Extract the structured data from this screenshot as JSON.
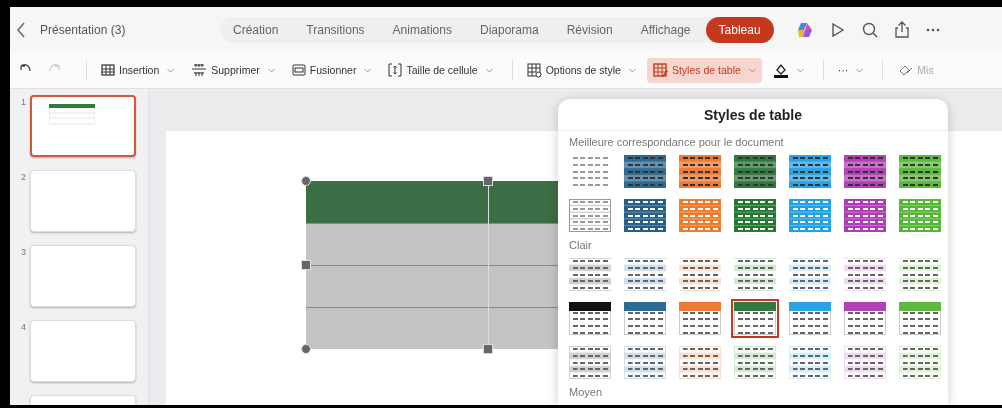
{
  "title_bar": {
    "document_title": "Présentation (3)",
    "tabs": [
      {
        "label": "Création",
        "selected": false
      },
      {
        "label": "Transitions",
        "selected": false
      },
      {
        "label": "Animations",
        "selected": false
      },
      {
        "label": "Diaporama",
        "selected": false
      },
      {
        "label": "Révision",
        "selected": false
      },
      {
        "label": "Affichage",
        "selected": false
      },
      {
        "label": "Tableau",
        "selected": true
      }
    ]
  },
  "toolbar": {
    "undo": {
      "disabled": false
    },
    "redo": {
      "disabled": true
    },
    "items": [
      {
        "kind": "insert",
        "label": "Insertion",
        "selected": false
      },
      {
        "kind": "delete",
        "label": "Supprimer",
        "selected": false
      },
      {
        "kind": "merge",
        "label": "Fusionner",
        "selected": false
      },
      {
        "kind": "size",
        "label": "Taille de cellule",
        "selected": false
      },
      {
        "kind": "options",
        "label": "Options de style",
        "selected": false
      },
      {
        "kind": "styles",
        "label": "Styles de table",
        "selected": true
      },
      {
        "kind": "fill",
        "selected": false
      },
      {
        "kind": "more",
        "label": "···",
        "selected": false
      },
      {
        "kind": "format",
        "label": "Mis",
        "selected": false
      }
    ]
  },
  "slides": [
    {
      "number": "1",
      "selected": true,
      "has_table": true
    },
    {
      "number": "2",
      "selected": false,
      "has_table": false
    },
    {
      "number": "3",
      "selected": false,
      "has_table": false
    },
    {
      "number": "4",
      "selected": false,
      "has_table": false
    },
    {
      "selected": false,
      "has_table": false
    }
  ],
  "styles_panel": {
    "title": "Styles de table",
    "sections": [
      {
        "heading": "Meilleure correspondance pour le document",
        "rows": [
          [
            {
              "kind": "plain",
              "color": "#9a9a9a",
              "selected": false
            },
            {
              "kind": "filled",
              "color": "#2e6b93",
              "selected": false
            },
            {
              "kind": "filled",
              "color": "#ee7a33",
              "selected": false
            },
            {
              "kind": "filled",
              "color": "#2f7a3c",
              "selected": false
            },
            {
              "kind": "filled",
              "color": "#2aa4e4",
              "selected": false
            },
            {
              "kind": "filled",
              "color": "#b43fb6",
              "selected": false
            },
            {
              "kind": "filled",
              "color": "#5cb83e",
              "selected": false
            }
          ],
          [
            {
              "kind": "grid",
              "color": "#9a9a9a",
              "selected": false
            },
            {
              "kind": "filled-lines",
              "color": "#24608a",
              "selected": false
            },
            {
              "kind": "filled-lines",
              "color": "#ee7a2c",
              "selected": false
            },
            {
              "kind": "filled-lines",
              "color": "#217a30",
              "selected": false
            },
            {
              "kind": "filled-lines",
              "color": "#22a2e6",
              "selected": false
            },
            {
              "kind": "filled-lines",
              "color": "#b23ab6",
              "selected": false
            },
            {
              "kind": "filled-lines",
              "color": "#55b834",
              "selected": false
            }
          ]
        ]
      },
      {
        "heading": "Clair",
        "rows": [
          [
            {
              "kind": "light-banded",
              "color": "#d2d2d2",
              "selected": false
            },
            {
              "kind": "light-banded",
              "color": "#d0e0ee",
              "selected": false
            },
            {
              "kind": "light-banded",
              "color": "#fbe0cf",
              "selected": false
            },
            {
              "kind": "light-banded",
              "color": "#d6ead6",
              "selected": false
            },
            {
              "kind": "light-banded",
              "color": "#d3edfa",
              "selected": false
            },
            {
              "kind": "light-banded",
              "color": "#f0dbf0",
              "selected": false
            },
            {
              "kind": "light-banded",
              "color": "#def2d6",
              "selected": false
            }
          ],
          [
            {
              "kind": "header",
              "color": "#111111",
              "selected": false
            },
            {
              "kind": "header",
              "color": "#2e6b93",
              "selected": false
            },
            {
              "kind": "header",
              "color": "#ee7a33",
              "selected": false
            },
            {
              "kind": "header",
              "color": "#2f7a3c",
              "selected": true
            },
            {
              "kind": "header",
              "color": "#2aa4e4",
              "selected": false
            },
            {
              "kind": "header",
              "color": "#b43fb6",
              "selected": false
            },
            {
              "kind": "header",
              "color": "#5cb83e",
              "selected": false
            }
          ],
          [
            {
              "kind": "light-grid",
              "color": "#d2d2d2",
              "selected": false
            },
            {
              "kind": "light-grid",
              "color": "#d0e0ee",
              "selected": false
            },
            {
              "kind": "light-grid",
              "color": "#fbe0cf",
              "selected": false
            },
            {
              "kind": "light-grid",
              "color": "#d6ead6",
              "selected": false
            },
            {
              "kind": "light-grid",
              "color": "#d3edfa",
              "selected": false
            },
            {
              "kind": "light-grid",
              "color": "#f0dbf0",
              "selected": false
            },
            {
              "kind": "light-grid",
              "color": "#def2d6",
              "selected": false
            }
          ]
        ]
      },
      {
        "heading": "Moyen"
      }
    ]
  }
}
